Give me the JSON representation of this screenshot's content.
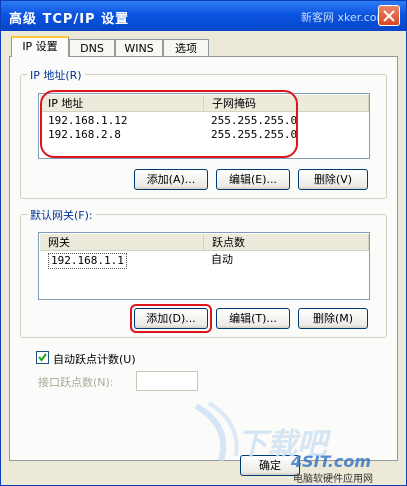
{
  "window": {
    "title": "高级 TCP/IP 设置",
    "watermark_top": "新客网 xker.com"
  },
  "tabs": [
    {
      "label": "IP 设置",
      "active": true
    },
    {
      "label": "DNS",
      "active": false
    },
    {
      "label": "WINS",
      "active": false
    },
    {
      "label": "选项",
      "active": false
    }
  ],
  "ip_section": {
    "label": "IP 地址(R)",
    "columns": [
      "IP 地址",
      "子网掩码"
    ],
    "rows": [
      {
        "ip": "192.168.1.12",
        "mask": "255.255.255.0"
      },
      {
        "ip": "192.168.2.8",
        "mask": "255.255.255.0"
      }
    ],
    "add": "添加(A)...",
    "edit": "编辑(E)...",
    "delete": "删除(V)"
  },
  "gateway_section": {
    "label": "默认网关(F):",
    "columns": [
      "网关",
      "跃点数"
    ],
    "rows": [
      {
        "gateway": "192.168.1.1",
        "metric": "自动"
      }
    ],
    "add": "添加(D)...",
    "edit": "编辑(T)...",
    "delete": "删除(M)"
  },
  "auto_metric": {
    "label": "自动跃点计数(U)",
    "checked": true,
    "interface_metric_label": "接口跃点数(N):",
    "interface_metric_value": ""
  },
  "footer": {
    "ok": "确定",
    "watermark_site": "下载吧",
    "watermark_logo": "4SIT.com",
    "watermark_sub": "电脑软硬件应用网"
  },
  "colors": {
    "highlight_ring": "#e0141e",
    "titlebar": "#0a54e0"
  }
}
